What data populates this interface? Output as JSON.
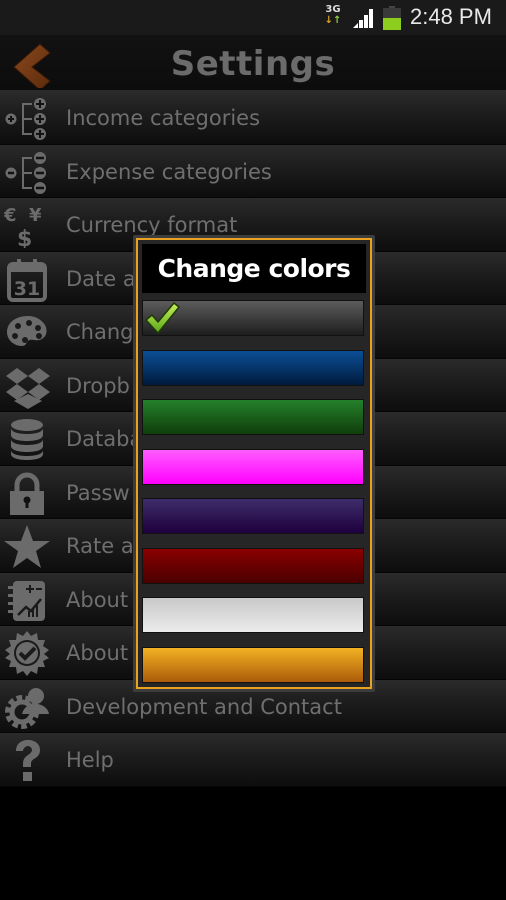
{
  "status_bar": {
    "network": "3G",
    "time": "2:48 PM",
    "icons": [
      "data-arrows-icon",
      "signal-icon",
      "battery-icon"
    ]
  },
  "header": {
    "title": "Settings",
    "back_icon": "back-arrow-icon"
  },
  "settings": {
    "items": [
      {
        "label": "Income categories",
        "icon": "income-categories-icon"
      },
      {
        "label": "Expense categories",
        "icon": "expense-categories-icon"
      },
      {
        "label": "Currency format",
        "icon": "currency-icon"
      },
      {
        "label": "Date a",
        "icon": "calendar-icon"
      },
      {
        "label": "Chang",
        "icon": "palette-icon"
      },
      {
        "label": "Dropb",
        "icon": "dropbox-icon"
      },
      {
        "label": "Databa",
        "icon": "database-icon"
      },
      {
        "label": "Passw",
        "icon": "lock-icon"
      },
      {
        "label": "Rate a",
        "icon": "star-icon"
      },
      {
        "label": "About",
        "icon": "notebook-chart-icon"
      },
      {
        "label": "About",
        "icon": "badge-check-icon"
      },
      {
        "label": "Development and Contact",
        "icon": "gear-person-icon"
      },
      {
        "label": "Help",
        "icon": "question-icon"
      }
    ]
  },
  "dialog": {
    "title": "Change colors",
    "border_color": "#e8a21f",
    "selected_index": 0,
    "options": [
      {
        "name": "gray",
        "top": "#5c5c5c",
        "bottom": "#1e1e1e"
      },
      {
        "name": "blue",
        "top": "#0b4f96",
        "bottom": "#001a3c"
      },
      {
        "name": "green",
        "top": "#24802a",
        "bottom": "#103e0c"
      },
      {
        "name": "magenta",
        "top": "#ff5cff",
        "bottom": "#ff00ff"
      },
      {
        "name": "purple",
        "top": "#3d2d6a",
        "bottom": "#1e003d"
      },
      {
        "name": "red",
        "top": "#8a0000",
        "bottom": "#4a0000"
      },
      {
        "name": "white",
        "top": "#c8c8c8",
        "bottom": "#ececec"
      },
      {
        "name": "orange",
        "top": "#f2b223",
        "bottom": "#ad5b0a"
      }
    ]
  }
}
